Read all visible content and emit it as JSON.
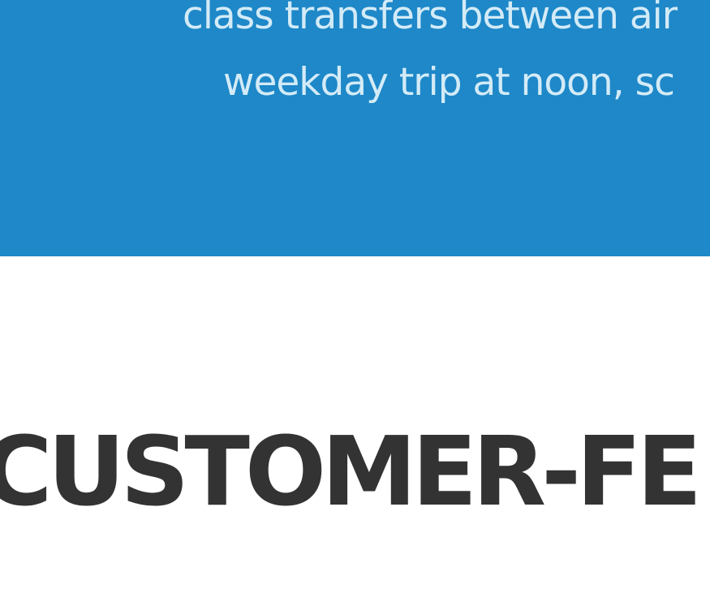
{
  "hero": {
    "background_color": "#1e88c8",
    "text_color": "#d3ebf7",
    "lines": [
      "class transfers between air",
      "weekday trip at noon, sc"
    ]
  },
  "section": {
    "title": "CUSTOMER-FE",
    "title_color": "#333333"
  }
}
